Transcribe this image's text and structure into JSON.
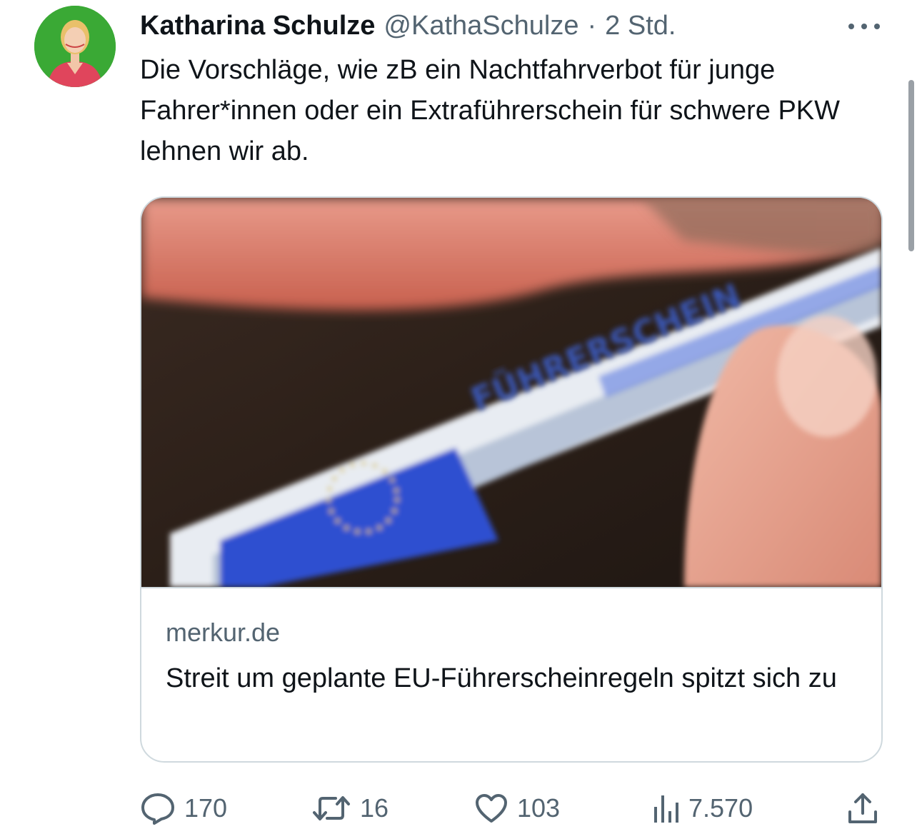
{
  "author": {
    "name": "Katharina Schulze",
    "handle": "@KathaSchulze",
    "separator": "·",
    "time": "2 Std."
  },
  "tweet": {
    "text": "Die Vorschläge, wie zB ein Nachtfahrverbot für junge Fahrer*innen oder ein Extraführerschein für schwere PKW lehnen wir ab."
  },
  "card": {
    "image_label": "FÜHRERSCHEIN",
    "domain": "merkur.de",
    "title": "Streit um geplante EU-Führerscheinregeln spitzt sich zu"
  },
  "actions": {
    "replies": "170",
    "retweets": "16",
    "likes": "103",
    "views": "7.570"
  },
  "icons": {
    "more": "more-horizontal-icon",
    "reply": "reply-icon",
    "retweet": "retweet-icon",
    "like": "heart-icon",
    "views": "analytics-icon",
    "share": "share-icon"
  },
  "colors": {
    "text": "#0f1419",
    "secondary": "#536471",
    "border": "#cfd9de",
    "avatar_bg": "#3aa935"
  }
}
